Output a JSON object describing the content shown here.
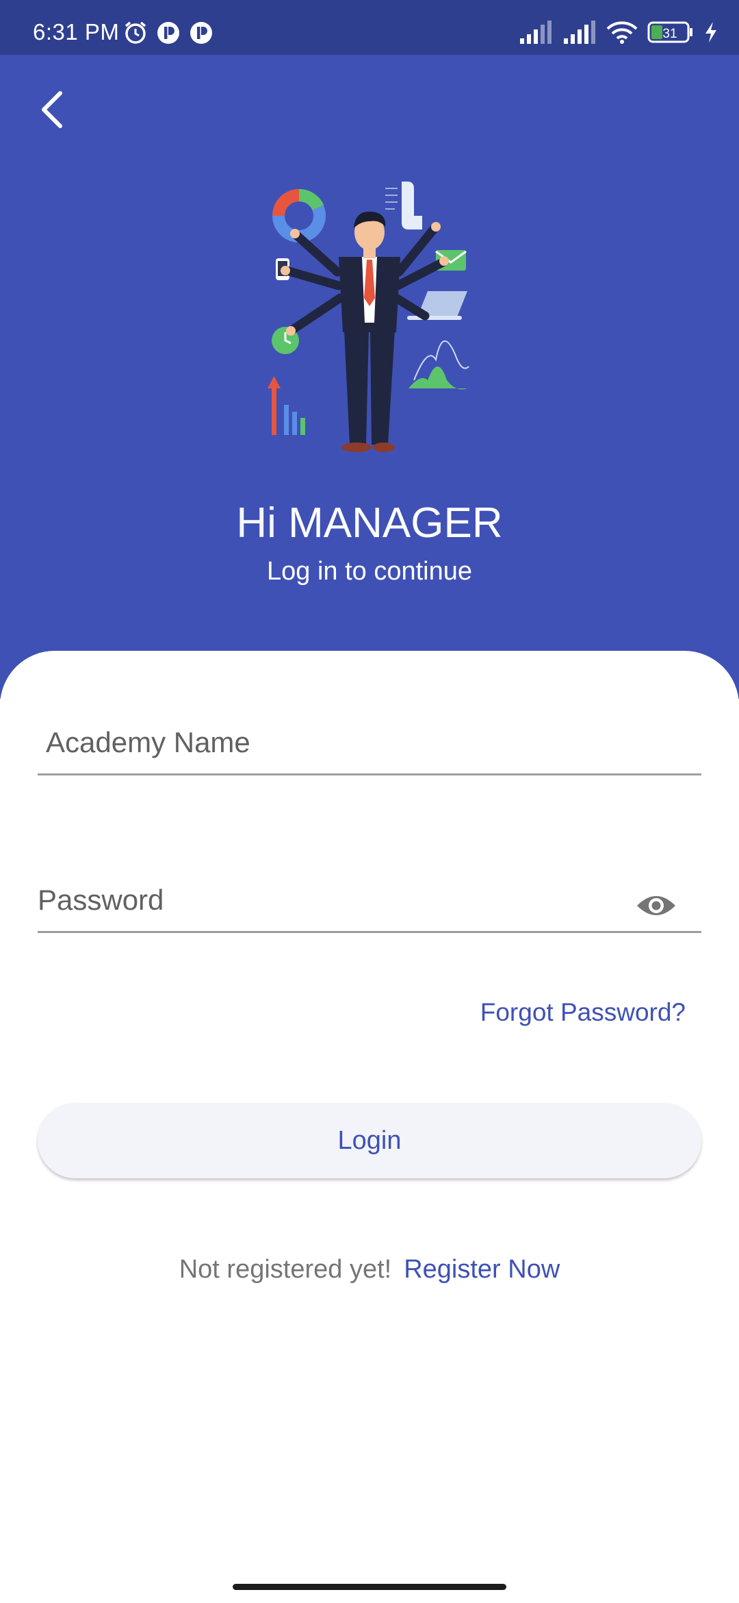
{
  "status_bar": {
    "time": "6:31 PM",
    "battery_level": "31",
    "icons": [
      "alarm-icon",
      "app-notification-icon",
      "app-notification-icon",
      "signal-icon",
      "signal-icon",
      "wifi-icon",
      "battery-icon",
      "charging-icon"
    ]
  },
  "header": {
    "back_icon": "chevron-left-icon",
    "greeting_hi": "Hi",
    "greeting_role": "MANAGER",
    "subtitle": "Log in to continue",
    "illustration": "multitasking-manager-illustration"
  },
  "form": {
    "academy_placeholder": "Academy Name",
    "academy_value": "",
    "password_placeholder": "Password",
    "password_value": "",
    "password_toggle_icon": "eye-icon",
    "forgot_label": "Forgot Password?",
    "login_label": "Login",
    "register_prompt": "Not registered yet!",
    "register_label": "Register Now"
  },
  "colors": {
    "primary": "#3f51b5",
    "status_bar": "#2f3f8f",
    "card": "#ffffff",
    "button_bg": "#f3f4fa"
  }
}
